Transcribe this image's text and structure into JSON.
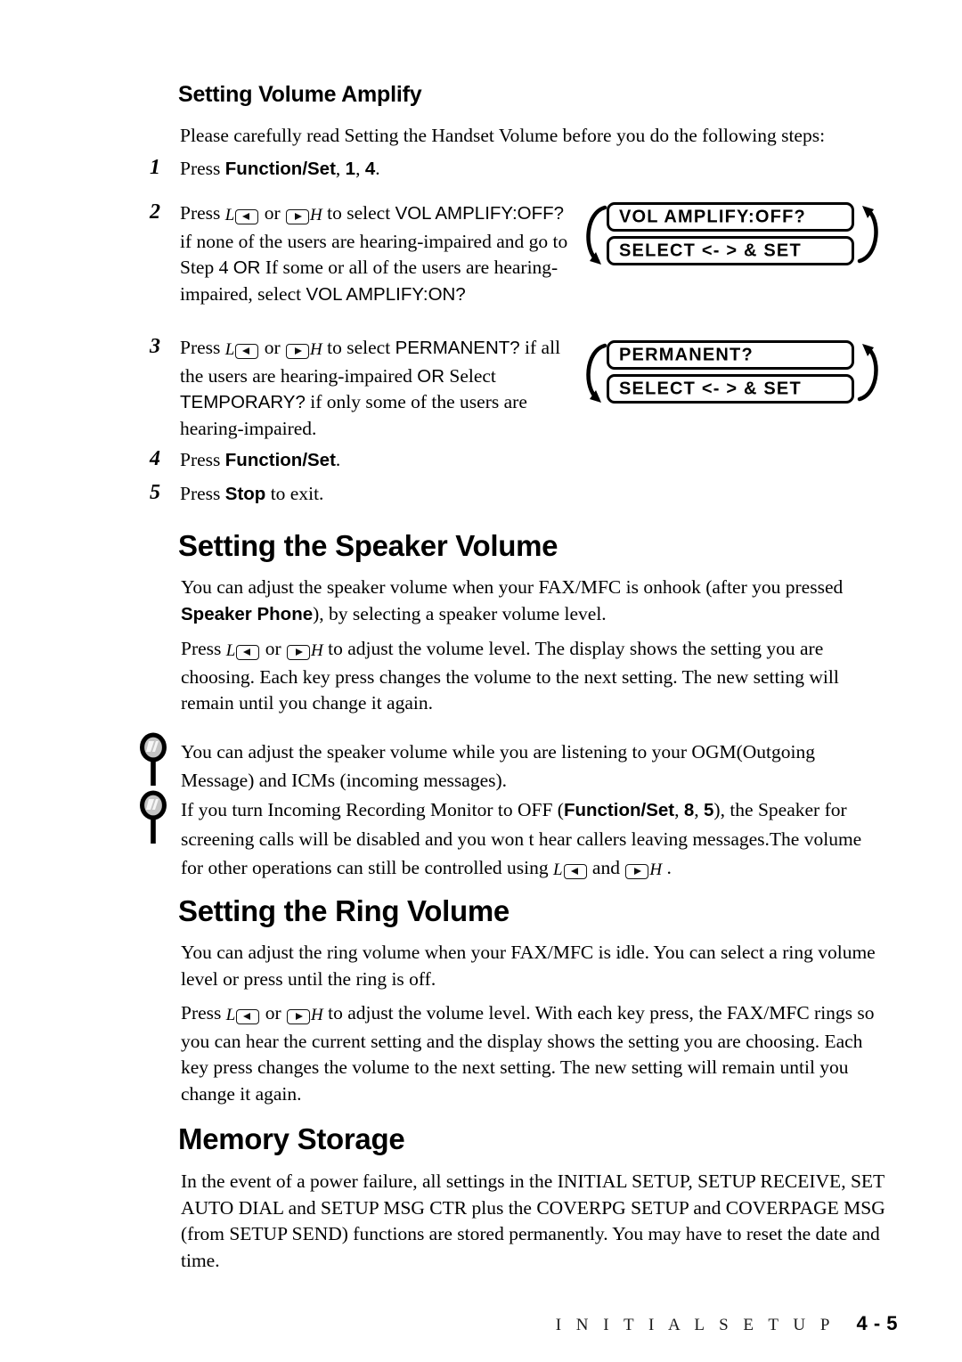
{
  "page": {
    "section_footer": "I N I T I A L   S E T U P",
    "page_number": "4 - 5"
  },
  "colors": {
    "text": "#000000",
    "lens_fill": "#bcbcbc",
    "lens_stroke": "#111111"
  },
  "sections": [
    {
      "id": "volume-amplify",
      "heading": "Setting Volume Amplify",
      "intro": "Please carefully read  Setting the Handset Volume  before you do the following steps:"
    },
    {
      "id": "speaker-volume",
      "heading": "Setting the Speaker Volume"
    },
    {
      "id": "ring-volume",
      "heading": "Setting the Ring Volume"
    },
    {
      "id": "memory-storage",
      "heading": "Memory Storage"
    }
  ],
  "steps": {
    "n1": "1",
    "n2": "2",
    "n3": "3",
    "n4": "4",
    "n5": "5",
    "s1": {
      "press": "Press ",
      "bold": "Function/Set",
      "rest": ", ",
      "arg1": "1",
      "comma": ", ",
      "arg2": "4",
      "period": "."
    },
    "s2": {
      "press": "Press ",
      "or": " or ",
      "mid": " to select ",
      "lcd1": "VOL AMPLIFY:OFF?",
      "body": "  if none of the users are hearing-impaired and go to Step 4   ",
      "or_word": "OR",
      "body2": " If some or all of the users are hearing-impaired, select ",
      "lcd2": "VOL AMPLIFY:ON?"
    },
    "s3": {
      "press": "Press ",
      "or": " or ",
      "mid": " to select ",
      "lcd1": "PERMANENT?",
      "body": " if all the users are hearing-impaired   ",
      "or_word": "OR",
      "body2": " Select ",
      "lcd2": "TEMPORARY?",
      "body3": " if only some of the users are hearing-impaired."
    },
    "s4": {
      "press": "Press ",
      "bold": "Function/Set",
      "period": "."
    },
    "s5": {
      "press": "Press ",
      "bold": "Stop",
      "rest": " to exit."
    }
  },
  "lcd_displays": [
    {
      "id": "vol-amplify-off",
      "line1": "VOL AMPLIFY:OFF?",
      "line2": "SELECT <- > & SET"
    },
    {
      "id": "permanent",
      "line1": "PERMANENT?",
      "line2": "SELECT <- > & SET"
    }
  ],
  "speaker_volume": {
    "p1_a": "You can adjust the speaker volume when your FAX/MFC  is onhook (after you pressed ",
    "p1_bold": "Speaker Phone",
    "p1_b": "), by selecting a speaker volume level.",
    "p2_a": "Press ",
    "p2_or": " or ",
    "p2_b": " to adjust the volume level. The display shows the setting you are choosing. Each key press changes the volume to the next setting. The new setting will remain until you change it again."
  },
  "notes": [
    {
      "id": "note-ogm",
      "icon": "magnifier-icon",
      "text": "You can adjust the speaker volume while you are listening to your OGM(Outgoing Message) and ICMs (incoming messages)."
    },
    {
      "id": "note-monitor",
      "icon": "magnifier-icon",
      "a": "If you turn Incoming Recording Monitor to OFF (",
      "bold": "Function/Set",
      "b": ", ",
      "arg1": "8",
      "c": ", ",
      "arg2": "5",
      "d": "), the Speaker for screening calls will be disabled and you won t hear callers leaving messages.The volume for other operations can still be controlled using ",
      "e": " and ",
      "f": " ."
    }
  ],
  "ring_volume": {
    "p1": "You can adjust the ring volume when your FAX/MFC is idle. You can select a ring volume level or press until the ring is off.",
    "p2_a": "Press ",
    "p2_or": " or ",
    "p2_b": " to adjust the volume level. With each key press, the FAX/MFC rings so you can hear the current setting and the display shows the setting you are choosing. Each key press changes the volume to the next setting. The new setting will remain until you change it again."
  },
  "memory_storage": {
    "p1": "In the event of a power failure, all settings in the INITIAL SETUP, SETUP RECEIVE, SET AUTO DIAL and SETUP MSG CTR plus the COVERPG SETUP and COVERPAGE MSG (from SETUP SEND) functions are stored permanently. You may have to reset the date and time."
  }
}
